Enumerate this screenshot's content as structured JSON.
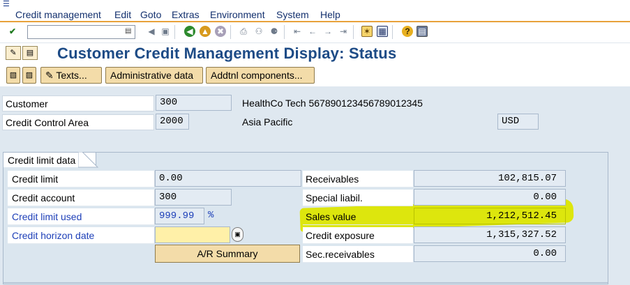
{
  "menu": {
    "items": [
      "Credit management",
      "Edit",
      "Goto",
      "Extras",
      "Environment",
      "System",
      "Help"
    ]
  },
  "toolbar": {
    "command_field_value": "",
    "icons": [
      "enter-icon",
      "back-icon",
      "exit-icon",
      "cancel-icon",
      "print-icon",
      "find-icon",
      "find-next-icon",
      "first-page-icon",
      "prev-page-icon",
      "next-page-icon",
      "last-page-icon",
      "create-session-icon",
      "shortcut-icon",
      "help-icon",
      "layout-menu-icon"
    ]
  },
  "title": {
    "text": "Customer Credit Management Display: Status"
  },
  "app_toolbar": {
    "texts_label": "Texts...",
    "admin_label": "Administrative data",
    "addtnl_label": "Addtnl components..."
  },
  "header_fields": {
    "customer_label": "Customer",
    "customer_value": "300",
    "customer_name": "HealthCo Tech 567890123456789012345",
    "cca_label": "Credit Control Area",
    "cca_value": "2000",
    "cca_name": "Asia Pacific",
    "currency": "USD"
  },
  "credit_limit_data": {
    "group_title": "Credit limit data",
    "left": {
      "credit_limit_label": "Credit limit",
      "credit_limit_value": "0.00",
      "credit_account_label": "Credit account",
      "credit_account_value": "300",
      "credit_limit_used_label": "Credit limit used",
      "credit_limit_used_value": "999.99",
      "percent_sign": "%",
      "credit_horizon_label": "Credit horizon date",
      "credit_horizon_value": "",
      "ar_summary_label": "A/R Summary"
    },
    "right": {
      "receivables_label": "Receivables",
      "receivables_value": "102,815.07",
      "special_liabil_label": "Special liabil.",
      "special_liabil_value": "0.00",
      "sales_value_label": "Sales value",
      "sales_value_value": "1,212,512.45",
      "credit_exposure_label": "Credit exposure",
      "credit_exposure_value": "1,315,327.52",
      "sec_receivables_label": "Sec.receivables",
      "sec_receivables_value": "0.00"
    }
  },
  "colors": {
    "title": "#1d4b86",
    "menu_accent": "#e8a23a",
    "button_bg": "#f3dca9",
    "body_bg": "#dfe8f0",
    "highlight": "#dde600",
    "blue_label": "#1d3fb8"
  }
}
